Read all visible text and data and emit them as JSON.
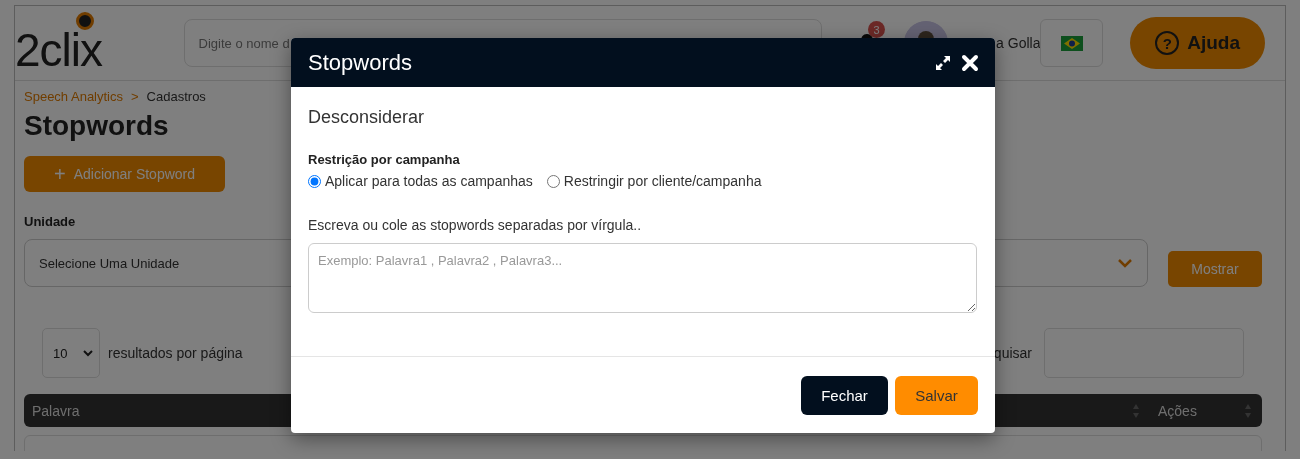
{
  "header": {
    "logo": "2clix",
    "search": {
      "placeholder": "Digite o nome d"
    },
    "notifications": {
      "count": "3"
    },
    "user": {
      "name": "a Golla"
    },
    "help_button": {
      "icon": "?",
      "label": "Ajuda"
    }
  },
  "breadcrumb": {
    "items": [
      {
        "label": "Speech Analytics",
        "selected": false
      },
      {
        "label": "Cadastros",
        "selected": true
      }
    ],
    "separator": ">"
  },
  "page_title": "Stopwords",
  "add_button": {
    "icon": "+",
    "label": "Adicionar Stopword"
  },
  "unit_field": {
    "label": "Unidade",
    "placeholder": "Selecione Uma Unidade"
  },
  "show_button": "Mostrar",
  "page_size": {
    "value": "10",
    "suffix": "resultados por página"
  },
  "search_label": "quisar",
  "table": {
    "columns": [
      {
        "label": "Palavra"
      },
      {
        "label": "Ações"
      }
    ]
  },
  "modal": {
    "title": "Stopwords",
    "section": "Desconsiderar",
    "restriction_label": "Restrição por campanha",
    "options": [
      {
        "label": "Aplicar para todas as campanhas",
        "selected": true
      },
      {
        "label": "Restringir por cliente/campanha",
        "selected": false
      }
    ],
    "textarea": {
      "label": "Escreva ou cole as stopwords separadas por vírgula..",
      "placeholder": "Exemplo: Palavra1 , Palavra2 , Palavra3..."
    },
    "buttons": [
      {
        "label": "Fechar",
        "kind": "secondary"
      },
      {
        "label": "Salvar",
        "kind": "primary"
      }
    ]
  }
}
